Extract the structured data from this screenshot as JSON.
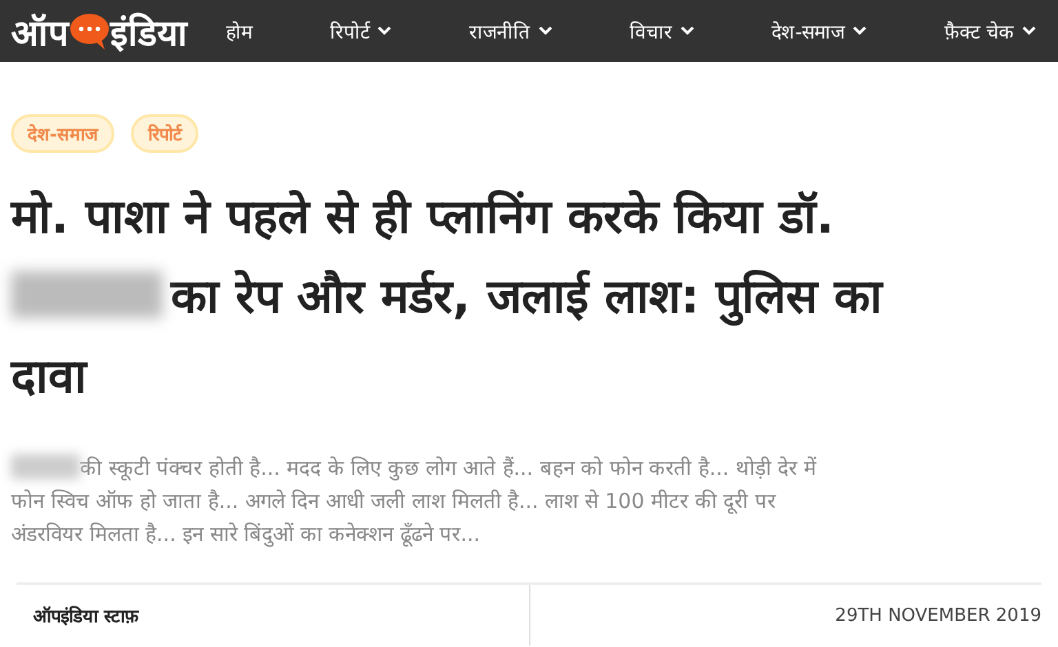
{
  "header": {
    "logo": {
      "left": "ऑप",
      "right": "इंडिया"
    },
    "nav": [
      {
        "label": "होम",
        "dropdown": false
      },
      {
        "label": "रिपोर्ट",
        "dropdown": true
      },
      {
        "label": "राजनीति",
        "dropdown": true
      },
      {
        "label": "विचार",
        "dropdown": true
      },
      {
        "label": "देश-समाज",
        "dropdown": true
      },
      {
        "label": "फ़ैक्ट चेक",
        "dropdown": true
      }
    ]
  },
  "article": {
    "tags": [
      "देश-समाज",
      "रिपोर्ट"
    ],
    "headline": [
      {
        "text": "मो. पाशा ने पहले से ही प्लानिंग करके किया डॉ.",
        "redacted_prefix": false
      },
      {
        "text": "का रेप और मर्डर, जलाई लाश: पुलिस का",
        "redacted_prefix": true
      },
      {
        "text": "दावा",
        "redacted_prefix": false
      }
    ],
    "excerpt": [
      {
        "text": "की स्कूटी पंक्चर होती है... मदद के लिए कुछ लोग आते हैं... बहन को फोन करती है... थोड़ी देर में",
        "redacted_prefix": true
      },
      {
        "text": "फोन स्विच ऑफ हो जाता है... अगले दिन आधी जली लाश मिलती है... लाश से 100 मीटर की दूरी पर",
        "redacted_prefix": false
      },
      {
        "text": "अंडरवियर मिलता है... इन सारे बिंदुओं का कनेक्शन ढूँढने पर...",
        "redacted_prefix": false
      }
    ],
    "author": "ऑपइंडिया स्टाफ़",
    "date": "29TH NOVEMBER 2019"
  }
}
